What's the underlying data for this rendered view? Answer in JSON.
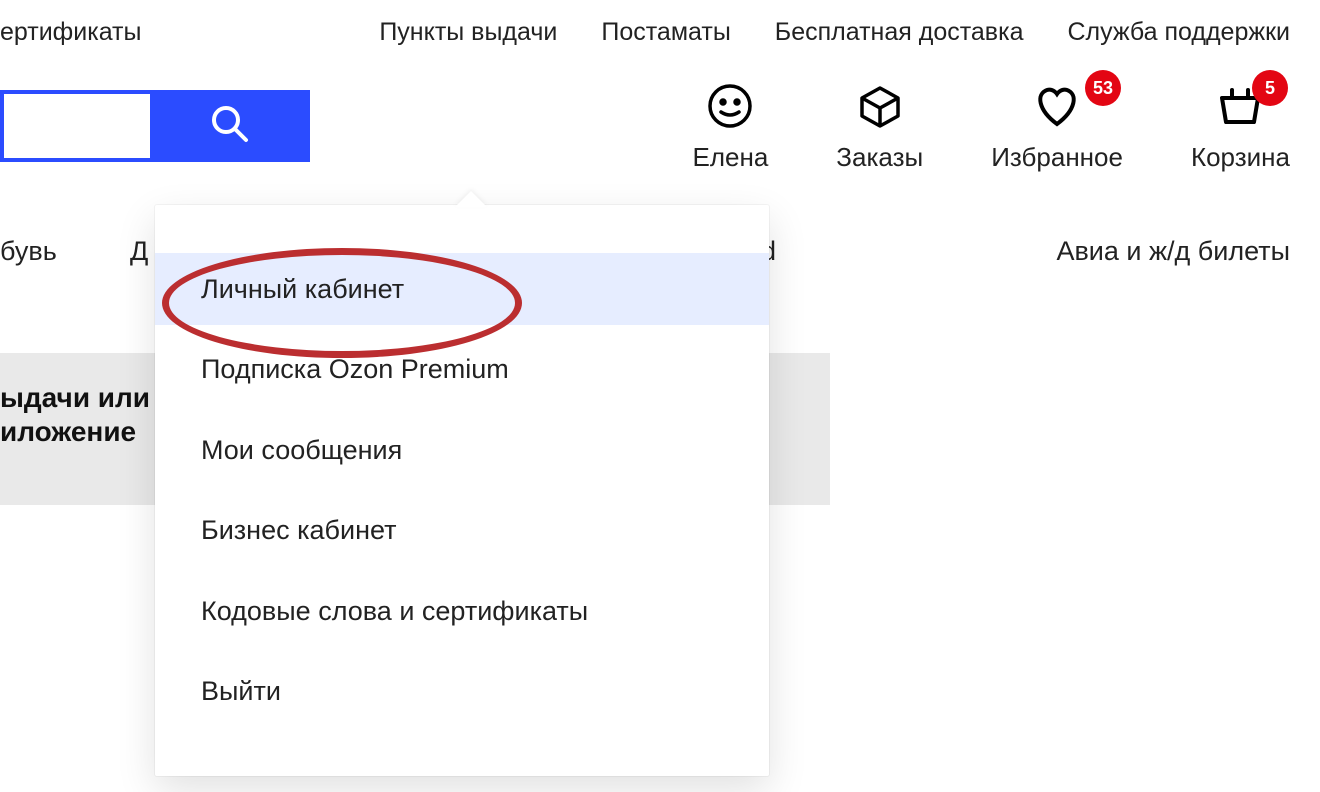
{
  "topLinks": {
    "frag_certificates": "ертификаты",
    "pickup": "Пункты выдачи",
    "lockers": "Постаматы",
    "free_delivery": "Бесплатная доставка",
    "support": "Служба поддержки"
  },
  "header": {
    "user": "Елена",
    "orders": "Заказы",
    "favorites": "Избранное",
    "cart": "Корзина",
    "favorites_count": "53",
    "cart_count": "5"
  },
  "categories": {
    "frag_shoes": "бувь",
    "frag_d": "Д",
    "frag_card": "ard",
    "avia": "Авиа и ж/д билеты"
  },
  "banner": {
    "line1": "ыдачи или",
    "line2": "иложение"
  },
  "dropdown": {
    "items": [
      "Личный кабинет",
      "Подписка Ozon Premium",
      "Мои сообщения",
      "Бизнес кабинет",
      "Кодовые слова и сертификаты",
      "Выйти"
    ]
  }
}
